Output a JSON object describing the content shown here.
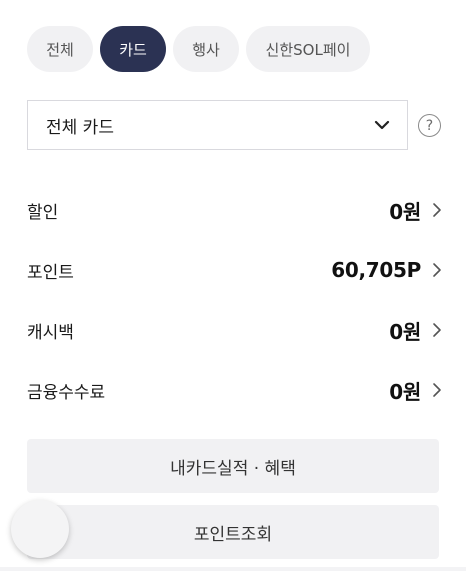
{
  "tabs": [
    {
      "label": "전체",
      "active": false
    },
    {
      "label": "카드",
      "active": true
    },
    {
      "label": "행사",
      "active": false
    },
    {
      "label": "신한SOL페이",
      "active": false
    }
  ],
  "filter": {
    "selected": "전체 카드",
    "help_symbol": "?"
  },
  "summary": [
    {
      "label": "할인",
      "value": "0원"
    },
    {
      "label": "포인트",
      "value": "60,705P"
    },
    {
      "label": "캐시백",
      "value": "0원"
    },
    {
      "label": "금융수수료",
      "value": "0원"
    }
  ],
  "buttons": {
    "performance": "내카드실적 · 혜택",
    "points": "포인트조회"
  },
  "colors": {
    "active_tab": "#2b3253",
    "tab_bg": "#f1f1f3"
  }
}
